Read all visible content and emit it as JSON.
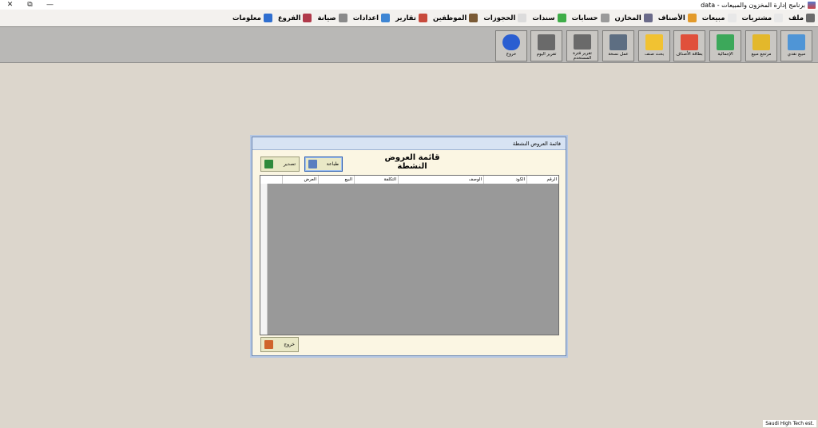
{
  "window": {
    "title": "برنامج إدارة المخزون والمبيعات - data",
    "controls": [
      "✕",
      "⧉",
      "—"
    ]
  },
  "menu": [
    {
      "label": "ملف",
      "color": "#6b6b6b"
    },
    {
      "label": "مشتريات",
      "color": "#e8e8e8"
    },
    {
      "label": "مبيعات",
      "color": "#e8e8e8"
    },
    {
      "label": "الأصناف",
      "color": "#e39a2a"
    },
    {
      "label": "المخازن",
      "color": "#6b6b8a"
    },
    {
      "label": "حسابات",
      "color": "#9a9a9a"
    },
    {
      "label": "سندات",
      "color": "#3fae49"
    },
    {
      "label": "الحجوزات",
      "color": "#dcdcdc"
    },
    {
      "label": "الموظفين",
      "color": "#7a5a35"
    },
    {
      "label": "تقارير",
      "color": "#c84a3c"
    },
    {
      "label": "اعدادات",
      "color": "#3f86d4"
    },
    {
      "label": "صيانة",
      "color": "#8a8a8a"
    },
    {
      "label": "الفروع",
      "color": "#b0394a"
    },
    {
      "label": "معلومات",
      "color": "#2f6fd0"
    }
  ],
  "toolbar": [
    {
      "label": "مبيع نقدي",
      "color": "#4f95d6"
    },
    {
      "label": "مرتجع مبيع",
      "color": "#e3b82b"
    },
    {
      "label": "الإجمالية",
      "color": "#3ca85a"
    },
    {
      "label": "بطاقة الأصناف",
      "color": "#e0503b"
    },
    {
      "label": "بحث صنف",
      "color": "#f1c232"
    },
    {
      "label": "عمل نسخة",
      "color": "#5d6e82"
    },
    {
      "label": "تقرير فترة المستخدم",
      "color": "#6a6a6a"
    },
    {
      "label": "تقرير اليوم",
      "color": "#6a6a6a"
    },
    {
      "label": "خروج",
      "color": "#2a5ed1"
    }
  ],
  "dialog": {
    "window_title": "قائمة العروض النشطة",
    "heading": "قائمة العروض النشطة",
    "print_label": "طباعة",
    "export_label": "تصدير",
    "exit_label": "خروج",
    "columns": [
      "الرقم",
      "الكود",
      "الوصف",
      "التكلفة",
      "البيع",
      "العرض"
    ]
  },
  "status": {
    "text": "Saudi High Tech est."
  }
}
